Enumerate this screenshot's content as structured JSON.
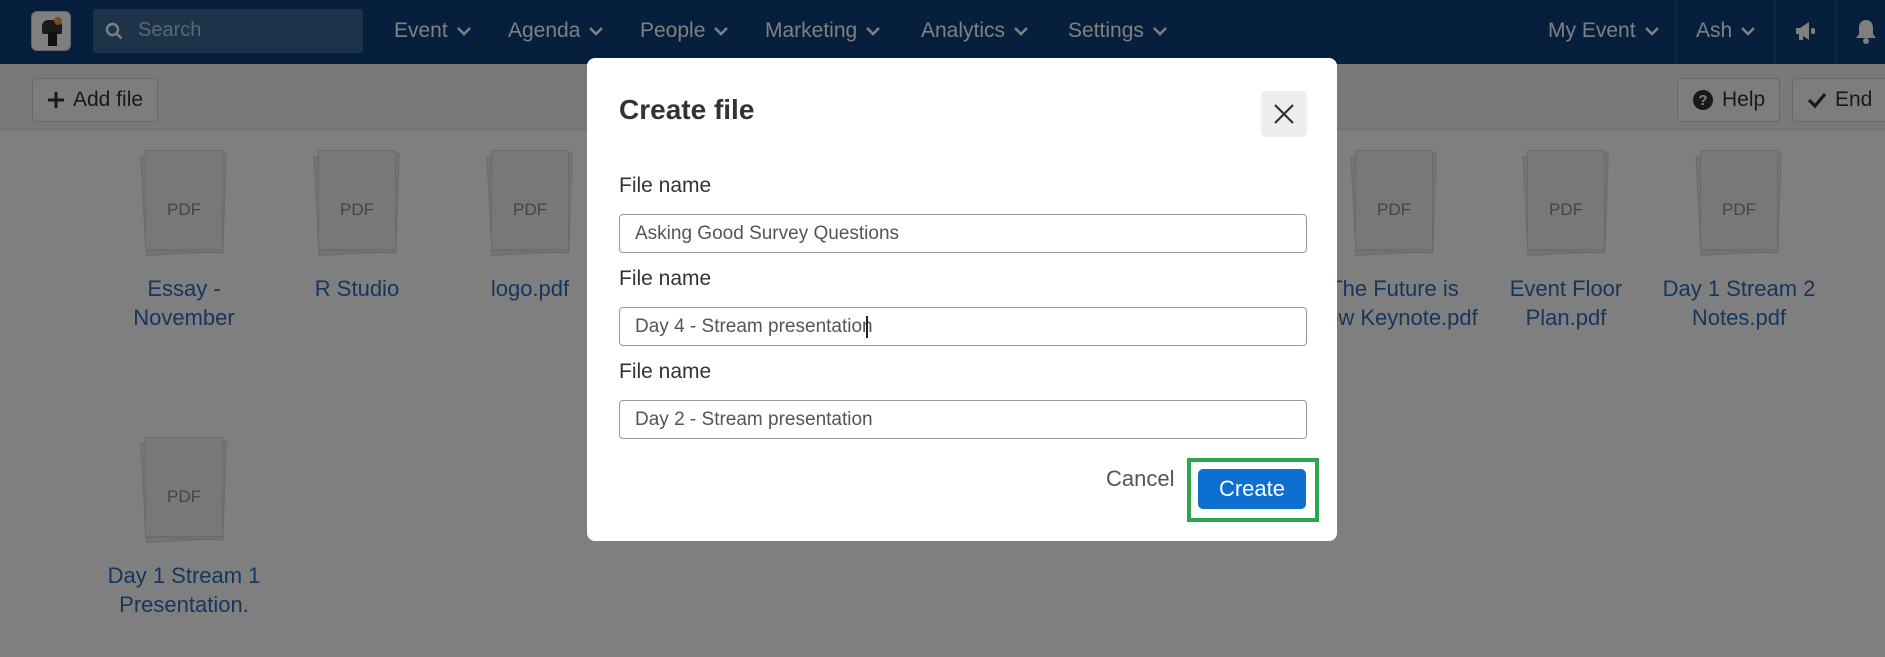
{
  "nav": {
    "search_placeholder": "Search",
    "items": [
      "Event",
      "Agenda",
      "People",
      "Marketing",
      "Analytics",
      "Settings"
    ],
    "right_items": [
      "My Event",
      "Ash"
    ]
  },
  "toolbar": {
    "add_file": "Add file",
    "help": "Help",
    "end": "End"
  },
  "files": [
    {
      "type": "PDF",
      "name": "Essay - November"
    },
    {
      "type": "PDF",
      "name": "R Studio"
    },
    {
      "type": "PDF",
      "name": "logo.pdf"
    },
    {
      "type": "PDF",
      "name": "The Future is Now Keynote.pdf"
    },
    {
      "type": "PDF",
      "name": "Event Floor Plan.pdf"
    },
    {
      "type": "PDF",
      "name": "Day 1 Stream 2 Notes.pdf"
    },
    {
      "type": "PDF",
      "name": "Day 1 Stream 1 Presentation."
    }
  ],
  "modal": {
    "title": "Create file",
    "fields": [
      {
        "label": "File name",
        "value": "Asking Good Survey Questions"
      },
      {
        "label": "File name",
        "value": "Day 4 - Stream presentation"
      },
      {
        "label": "File name",
        "value": "Day 2 - Stream presentation"
      }
    ],
    "cancel": "Cancel",
    "create": "Create"
  },
  "colors": {
    "nav_bg": "#0d3f78",
    "primary": "#0d6fd0",
    "highlight": "#2da44e"
  }
}
